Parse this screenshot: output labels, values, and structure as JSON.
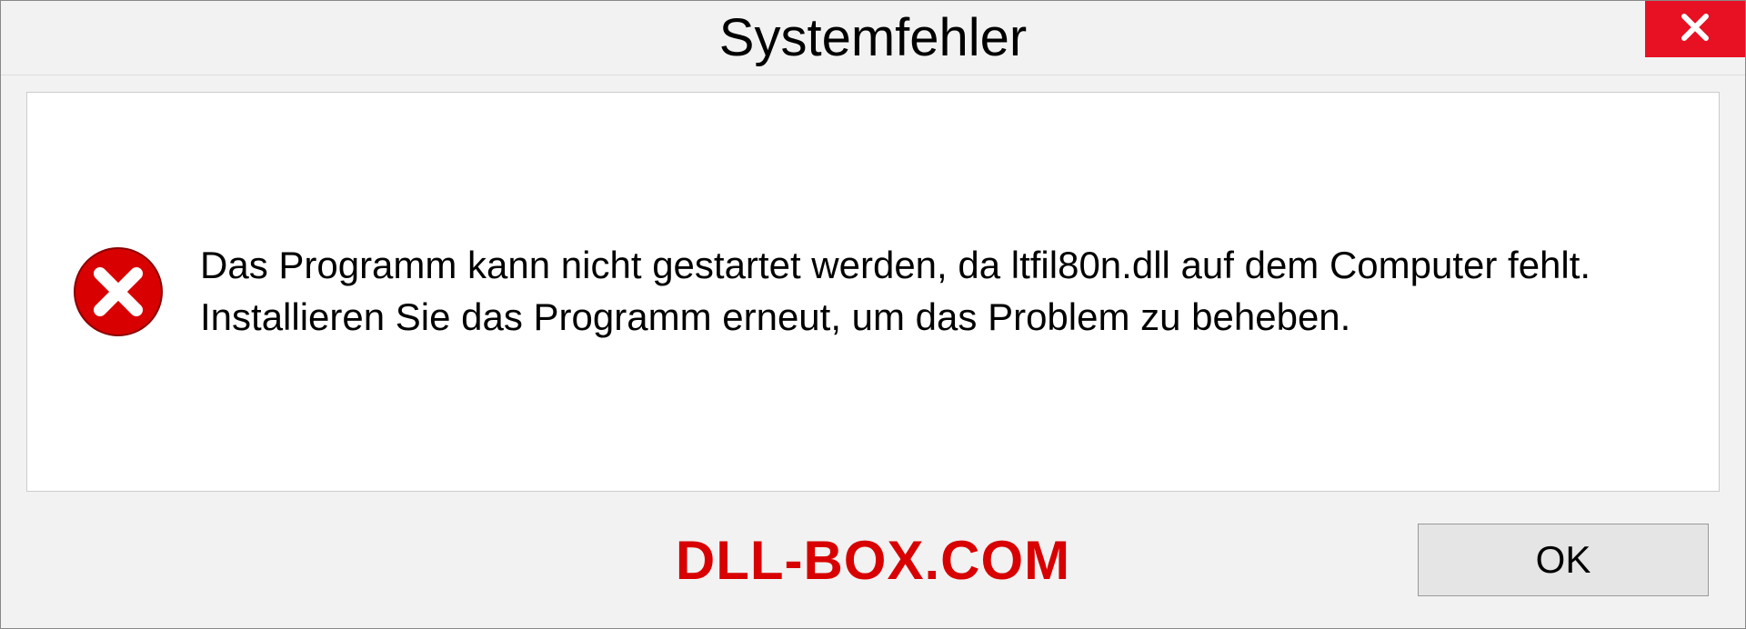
{
  "dialog": {
    "title": "Systemfehler",
    "message": "Das Programm kann nicht gestartet werden, da ltfil80n.dll auf dem Computer fehlt. Installieren Sie das Programm erneut, um das Problem zu beheben.",
    "ok_label": "OK",
    "watermark": "DLL-BOX.COM"
  },
  "colors": {
    "close_bg": "#e81123",
    "error_icon": "#d80000",
    "watermark": "#d80000"
  }
}
